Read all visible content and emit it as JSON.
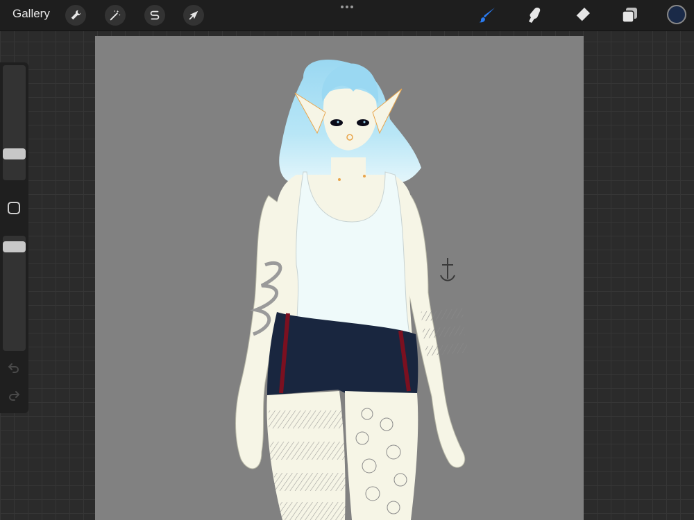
{
  "topbar": {
    "gallery_label": "Gallery",
    "left_tools": [
      {
        "name": "actions",
        "icon": "wrench-icon"
      },
      {
        "name": "adjustments",
        "icon": "magic-wand-icon"
      },
      {
        "name": "selection",
        "icon": "selection-s-icon"
      },
      {
        "name": "transform",
        "icon": "arrow-cursor-icon"
      }
    ],
    "more_icon": "more-dots-icon",
    "right_tools": [
      {
        "name": "paint",
        "icon": "brush-icon",
        "active": true
      },
      {
        "name": "smudge",
        "icon": "smudge-finger-icon",
        "active": false
      },
      {
        "name": "erase",
        "icon": "eraser-icon",
        "active": false
      },
      {
        "name": "layers",
        "icon": "layers-icon",
        "active": false
      }
    ],
    "current_color": "#1a2a48",
    "active_tool_color": "#2a7bf0"
  },
  "sidebar": {
    "brush_size_level": 0.2,
    "opacity_level": 0.95,
    "modify_icon": "square-modify-icon",
    "undo_icon": "undo-arrow-icon",
    "redo_icon": "redo-arrow-icon"
  },
  "canvas": {
    "background": "#818181",
    "artwork": "character-illustration",
    "palette": {
      "skin": "#f6f5e6",
      "hair_top": "#9ad8f2",
      "hair_bottom": "#e4f6fb",
      "tank_top": "#effafa",
      "shorts": "#19263f",
      "stripe": "#7b1020",
      "accent_gold": "#e8a44a"
    }
  }
}
